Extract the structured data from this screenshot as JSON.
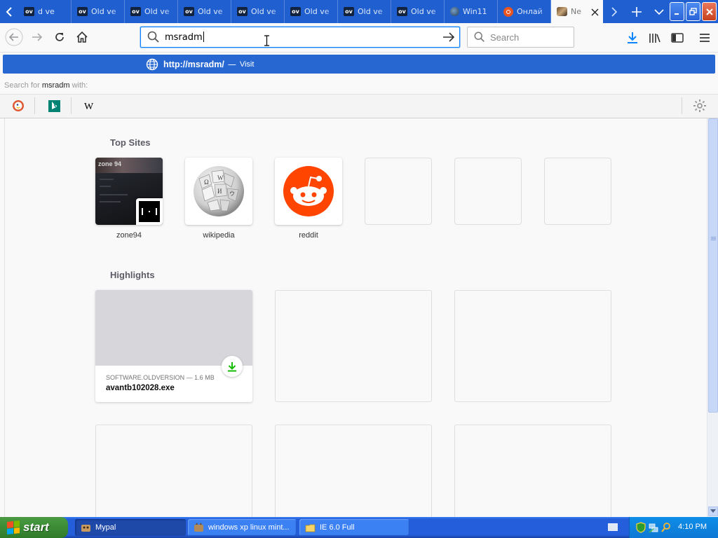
{
  "tabs": [
    {
      "label": "d ve",
      "icon": "oldversion-icon"
    },
    {
      "label": "Old ve",
      "icon": "oldversion-icon"
    },
    {
      "label": "Old ve",
      "icon": "oldversion-icon"
    },
    {
      "label": "Old ve",
      "icon": "oldversion-icon"
    },
    {
      "label": "Old ve",
      "icon": "oldversion-icon"
    },
    {
      "label": "Old ve",
      "icon": "oldversion-icon"
    },
    {
      "label": "Old ve",
      "icon": "oldversion-icon"
    },
    {
      "label": "Old ve",
      "icon": "oldversion-icon"
    },
    {
      "label": "Win11",
      "icon": "globe-dark-icon"
    },
    {
      "label": "Онлай",
      "icon": "ubuntu-icon"
    },
    {
      "label": "Ne",
      "icon": "cat-icon",
      "active": true
    }
  ],
  "favicon_text": "ov",
  "urlbar": {
    "value": "msradm"
  },
  "searchbar": {
    "placeholder": "Search"
  },
  "dropdown": {
    "visit_url": "http://msradm/",
    "dash": "—",
    "visit_label": "Visit",
    "search_prefix": "Search for",
    "search_term": "msradm",
    "search_suffix": "with:"
  },
  "topsites": {
    "title": "Top Sites",
    "sites": [
      {
        "label": "zone94"
      },
      {
        "label": "wikipedia"
      },
      {
        "label": "reddit"
      },
      {
        "label": ""
      },
      {
        "label": ""
      },
      {
        "label": ""
      }
    ],
    "zone_logo": "zone 94"
  },
  "highlights": {
    "title": "Highlights",
    "card": {
      "meta": "SOFTWARE.OLDVERSION — 1.6 MB",
      "filename": "avantb102028.exe"
    }
  },
  "taskbar": {
    "start_label": "start",
    "tasks": [
      {
        "label": "Mypal",
        "active": true
      },
      {
        "label": "windows xp linux mint...",
        "active": false
      },
      {
        "label": "IE 6.0 Full",
        "active": false
      }
    ],
    "clock": "4:10 PM"
  },
  "colors": {
    "tabstrip": "#1f5fd0",
    "visit_row": "#2767d1",
    "reddit": "#ff4500",
    "download_green": "#12bc00"
  }
}
